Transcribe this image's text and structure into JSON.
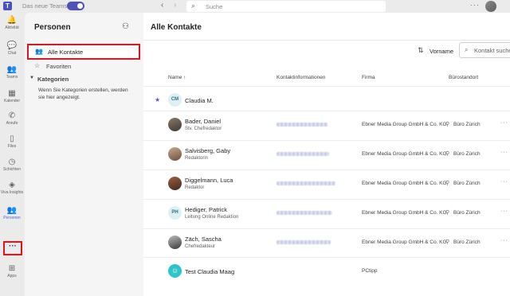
{
  "titlebar": {
    "app_logo": "T",
    "new_teams_label": "Das neue Teams",
    "search_placeholder": "Suche",
    "nav_back": "‹",
    "nav_forward": "›",
    "more": "···"
  },
  "rail": {
    "items": [
      {
        "label": "Aktivität",
        "icon": "bell-icon",
        "glyph": "🔔"
      },
      {
        "label": "Chat",
        "icon": "chat-icon",
        "glyph": "💬"
      },
      {
        "label": "Teams",
        "icon": "teams-icon",
        "glyph": "👥"
      },
      {
        "label": "Kalender",
        "icon": "calendar-icon",
        "glyph": "▦"
      },
      {
        "label": "Anrufe",
        "icon": "phone-icon",
        "glyph": "✆"
      },
      {
        "label": "Files",
        "icon": "file-icon",
        "glyph": "▯"
      },
      {
        "label": "Schichten",
        "icon": "shifts-icon",
        "glyph": "◷"
      },
      {
        "label": "Viva Insights",
        "icon": "insights-icon",
        "glyph": "◈"
      },
      {
        "label": "Personen",
        "icon": "people-icon",
        "glyph": "👥"
      }
    ],
    "more_label": "···",
    "apps_label": "Apps",
    "apps_glyph": "⊞"
  },
  "left_pane": {
    "title": "Personen",
    "nav": {
      "all_contacts": "Alle Kontakte",
      "favorites": "Favoriten"
    },
    "categories_header": "Kategorien",
    "categories_hint": "Wenn Sie Kategorien erstellen, werden sie hier angezeigt."
  },
  "main": {
    "title": "Alle Kontakte",
    "sort_label": "Vorname",
    "filter_placeholder": "Kontakt suchen",
    "columns": {
      "name": "Name ↑",
      "contact": "Kontaktinformationen",
      "company": "Firma",
      "location": "Bürostandort"
    },
    "rows": [
      {
        "name": "Claudia M.",
        "role": "",
        "initials": "CM",
        "favorite": true,
        "company": "",
        "location": ""
      },
      {
        "name": "Bader, Daniel",
        "role": "Stv. Chefredaktor",
        "initials": "",
        "favorite": false,
        "company": "Ebner Media Group GmbH & Co. KG",
        "location": "Büro Zürich"
      },
      {
        "name": "Salvisberg, Gaby",
        "role": "Redaktorin",
        "initials": "",
        "favorite": false,
        "company": "Ebner Media Group GmbH & Co. KG",
        "location": "Büro Zürich"
      },
      {
        "name": "Diggelmann, Luca",
        "role": "Redaktor",
        "initials": "",
        "favorite": false,
        "company": "Ebner Media Group GmbH & Co. KG",
        "location": "Büro Zürich"
      },
      {
        "name": "Hediger, Patrick",
        "role": "Leitung Online Redaktion",
        "initials": "PH",
        "favorite": false,
        "company": "Ebner Media Group GmbH & Co. KG",
        "location": "Büro Zürich"
      },
      {
        "name": "Zäch, Sascha",
        "role": "Chefredakteur",
        "initials": "",
        "favorite": false,
        "company": "Ebner Media Group GmbH & Co. KG",
        "location": "Büro Zürich"
      },
      {
        "name": "Test Claudia Maag",
        "role": "",
        "initials": "☺",
        "favorite": false,
        "company": "PCtipp",
        "location": ""
      }
    ]
  },
  "colors": {
    "accent": "#5b5fc7",
    "highlight_border": "#e0131f"
  }
}
